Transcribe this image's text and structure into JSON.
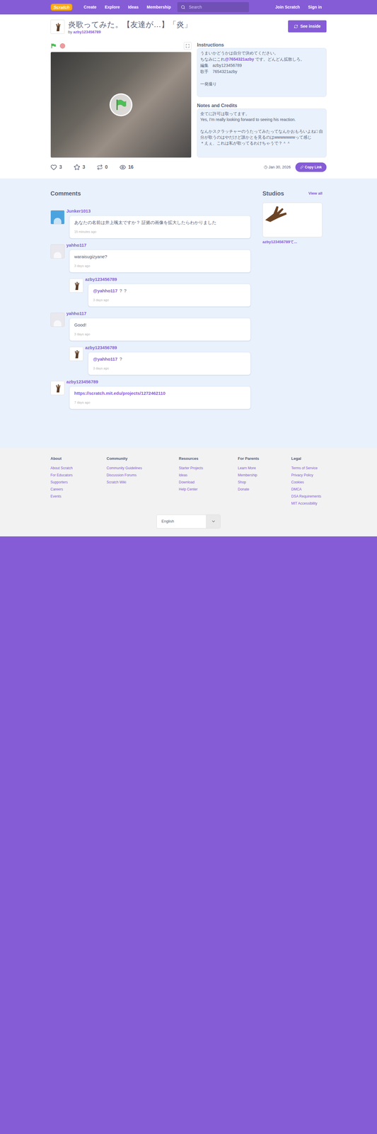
{
  "navbar": {
    "logo": "Scratch",
    "items": [
      "Create",
      "Explore",
      "Ideas",
      "Membership"
    ],
    "search_placeholder": "Search",
    "join": "Join Scratch",
    "sign_in": "Sign in"
  },
  "project": {
    "title": "炎歌ってみた。【友達が…】「炎」",
    "by": "by",
    "author": "azby123456789",
    "see_inside": "See inside",
    "instructions_label": "Instructions",
    "instructions": [
      [
        {
          "t": "うまいかどうかは自分で決めてください。",
          "link": false
        }
      ],
      [
        {
          "t": "ちなみにこれ",
          "link": false
        },
        {
          "t": "@7654321azby",
          "link": true
        },
        {
          "t": " です。どんどん拡散しろ。",
          "link": false
        }
      ],
      [
        {
          "t": "編集　azby123456789",
          "link": false
        }
      ],
      [
        {
          "t": "歌手　7654321azby",
          "link": false
        }
      ],
      [
        {
          "t": "",
          "link": false
        }
      ],
      [
        {
          "t": "一発撮り",
          "link": false
        }
      ]
    ],
    "notes_label": "Notes and Credits",
    "notes": [
      "全てに許可は取ってます。",
      "Yes, I'm really looking forward to seeing his reaction.",
      "",
      "なんかスクラッチャーのうたってみたってなんかおもろいよね□ 自分が歌うのはやだけど誰かとを見るのはwwwwwwwって感じ",
      "＊えぇ、これは私が歌ってるわけちゃうで？＾＾"
    ],
    "stats": {
      "loves": "3",
      "loved": false,
      "favorites": "3",
      "favorited": false,
      "remixes": "0",
      "views": "16"
    },
    "date": "Jan 30, 2026",
    "copy_link": "Copy Link"
  },
  "comments_title": "Comments",
  "comments": [
    {
      "user": "Junker1013",
      "color": "#4aa3df",
      "text": "あなたの名前は井上颯太ですか？ 証拠の画像を拡大したらわかりました",
      "time": "15 minutes ago",
      "replies": []
    },
    {
      "user": "yahho117",
      "color": "#e8e8ee",
      "text": "waraisugizyane?",
      "time": "3 days ago",
      "replies": [
        {
          "user": "azby123456789",
          "color": "#ffffff",
          "mention": "@yahho117",
          "text": " ？？",
          "time": "3 days ago"
        }
      ]
    },
    {
      "user": "yahho117",
      "color": "#e8e8ee",
      "text": "Good!",
      "time": "3 days ago",
      "replies": [
        {
          "user": "azby123456789",
          "color": "#ffffff",
          "mention": "@yahho117",
          "text": " ？",
          "time": "3 days ago"
        }
      ]
    },
    {
      "user": "azby123456789",
      "color": "#ffffff",
      "text": "https://scratch.mit.edu/projects/1272462110",
      "link": true,
      "time": "7 days ago",
      "replies": []
    }
  ],
  "studios": {
    "title": "Studios",
    "view_all": "View all",
    "items": [
      {
        "name": "azby123456789て..."
      }
    ]
  },
  "footer": {
    "columns": [
      {
        "title": "About",
        "links": [
          "About Scratch",
          "For Educators",
          "Supporters",
          "Careers",
          "Events"
        ]
      },
      {
        "title": "Community",
        "links": [
          "Community Guidelines",
          "Discussion Forums",
          "Scratch Wiki"
        ]
      },
      {
        "title": "Resources",
        "links": [
          "Starter Projects",
          "Ideas",
          "Download",
          "Help Center"
        ]
      },
      {
        "title": "For Parents",
        "links": [
          "Learn More",
          "Membership",
          "Shop",
          "Donate"
        ]
      },
      {
        "title": "Legal",
        "links": [
          "Terms of Service",
          "Privacy Policy",
          "Cookies",
          "DMCA",
          "DSA Requirements",
          "MIT Accessibility"
        ]
      }
    ],
    "language": "English"
  }
}
